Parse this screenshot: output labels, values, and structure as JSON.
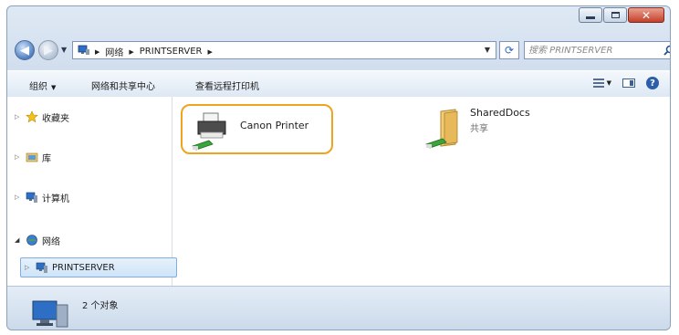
{
  "window": {
    "caption_buttons": [
      "minimize-icon",
      "maximize-icon",
      "close-icon"
    ]
  },
  "address": {
    "crumbs": [
      "网络",
      "PRINTSERVER"
    ],
    "search_placeholder": "搜索 PRINTSERVER"
  },
  "toolbar": {
    "organize": "组织",
    "network_sharing_center": "网络和共享中心",
    "view_remote_printers": "查看远程打印机"
  },
  "nav": {
    "items": [
      {
        "label": "收藏夹",
        "icon": "star-icon"
      },
      {
        "label": "库",
        "icon": "library-icon"
      },
      {
        "label": "计算机",
        "icon": "computer-icon"
      },
      {
        "label": "网络",
        "icon": "network-icon"
      },
      {
        "label": "PRINTSERVER",
        "icon": "server-icon"
      }
    ]
  },
  "files": [
    {
      "name": "Canon Printer",
      "type": "",
      "icon": "printer-icon",
      "highlighted": true
    },
    {
      "name": "SharedDocs",
      "type": "共享",
      "icon": "shared-folder-icon",
      "highlighted": false
    }
  ],
  "status": {
    "count_text": "2 个对象"
  },
  "colors": {
    "highlight": "#f0a31e",
    "accent": "#2d5fa8"
  }
}
